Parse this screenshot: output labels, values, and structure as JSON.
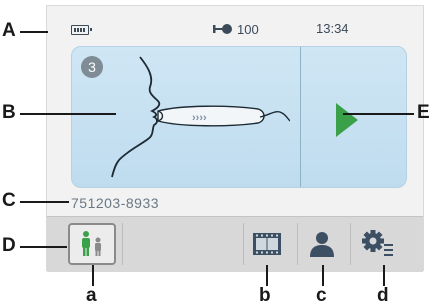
{
  "status": {
    "battery_icon": "battery-icon",
    "flow_value": "100",
    "time": "13:34"
  },
  "panel": {
    "step_number": "3"
  },
  "patient_id": "751203-8933",
  "toolbar": {
    "items": [
      {
        "name": "mode-button",
        "icon": "person-pair-icon"
      },
      {
        "name": "film-button",
        "icon": "film-icon"
      },
      {
        "name": "user-button",
        "icon": "user-icon"
      },
      {
        "name": "settings-button",
        "icon": "gear-list-icon"
      }
    ]
  },
  "callouts": {
    "A": "A",
    "B": "B",
    "C": "C",
    "D": "D",
    "E": "E",
    "a": "a",
    "b": "b",
    "c": "c",
    "d": "d"
  },
  "colors": {
    "panel": "#c7e1f2",
    "play": "#3aa14a",
    "person_active": "#3aa14a"
  }
}
